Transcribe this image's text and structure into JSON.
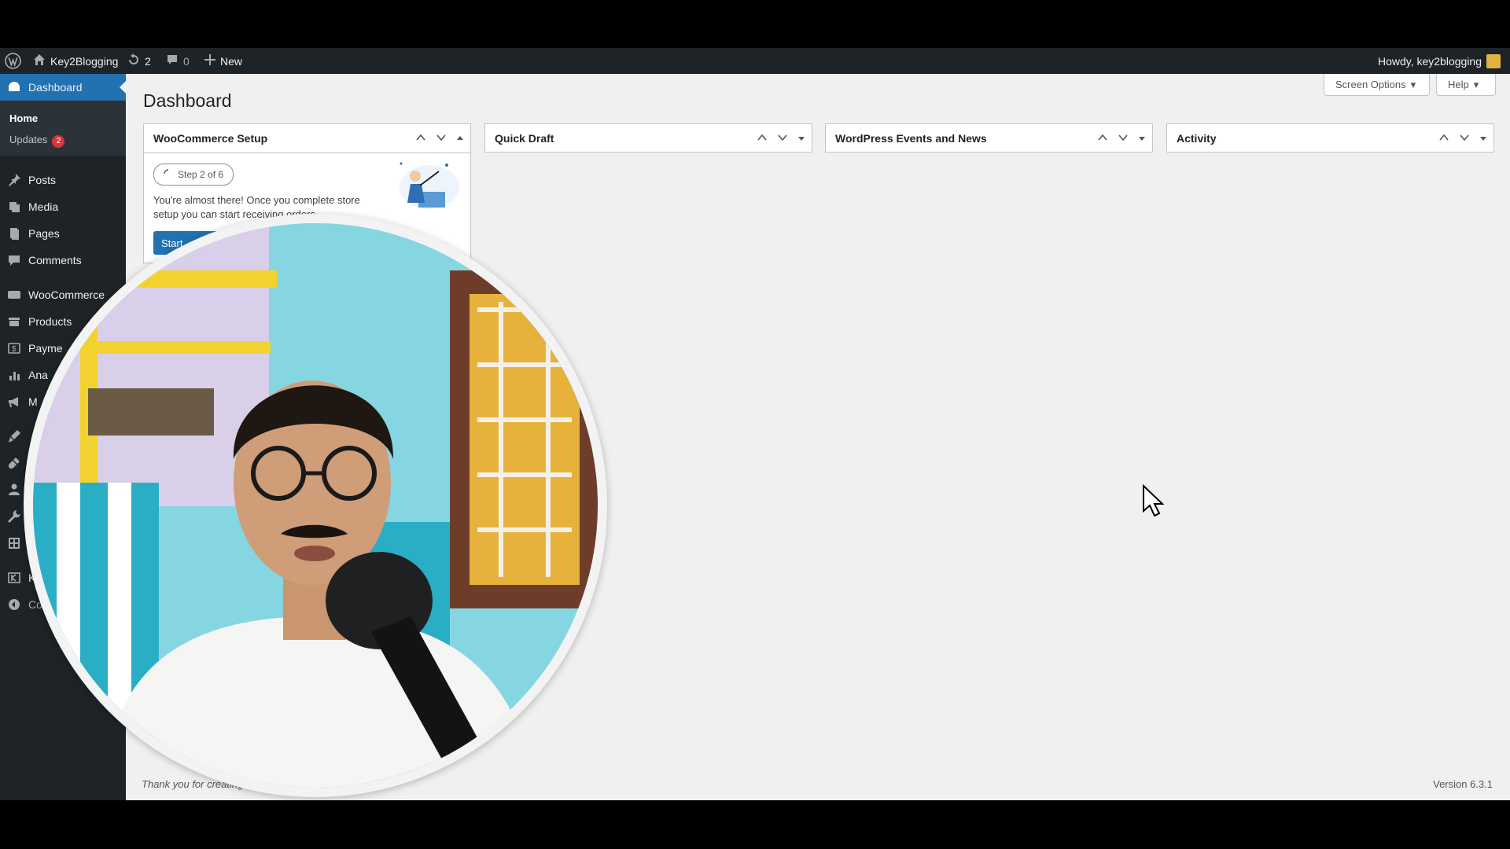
{
  "adminbar": {
    "site_name": "Key2Blogging",
    "updates_count": "2",
    "comments_count": "0",
    "new_label": "New",
    "howdy": "Howdy, key2blogging"
  },
  "sidebar": {
    "dashboard_label": "Dashboard",
    "submenu": {
      "home": "Home",
      "updates": "Updates",
      "updates_badge": "2"
    },
    "items": [
      {
        "label": "Posts",
        "icon": "pin-icon"
      },
      {
        "label": "Media",
        "icon": "media-icon"
      },
      {
        "label": "Pages",
        "icon": "pages-icon"
      },
      {
        "label": "Comments",
        "icon": "comment-icon"
      },
      {
        "label": "WooCommerce",
        "icon": "woo-icon"
      },
      {
        "label": "Products",
        "icon": "products-icon"
      },
      {
        "label": "Payme",
        "icon": "payments-icon"
      },
      {
        "label": "Ana",
        "icon": "analytics-icon"
      },
      {
        "label": "M",
        "icon": "marketing-icon"
      },
      {
        "label": "",
        "icon": "appearance-icon"
      },
      {
        "label": "",
        "icon": "plugins-icon"
      },
      {
        "label": "",
        "icon": "users-icon"
      },
      {
        "label": "",
        "icon": "tools-icon"
      },
      {
        "label": "",
        "icon": "settings-icon"
      },
      {
        "label": "K",
        "icon": "kadence-icon"
      },
      {
        "label": "Col",
        "icon": "collapse-icon"
      }
    ]
  },
  "main": {
    "title": "Dashboard",
    "screen_options": "Screen Options",
    "help": "Help",
    "widgets": {
      "woo_setup": {
        "title": "WooCommerce Setup",
        "step": "Step 2 of 6",
        "text": "You're almost there! Once you complete store setup you can start receiving orders.",
        "button": "Start"
      },
      "quick_draft": {
        "title": "Quick Draft"
      },
      "events": {
        "title": "WordPress Events and News"
      },
      "activity": {
        "title": "Activity"
      }
    },
    "footer_thanks": "Thank you for creating with WordPress.",
    "version": "Version 6.3.1"
  },
  "colors": {
    "adminbar_bg": "#1d2327",
    "accent": "#2271b1",
    "badge": "#d63638",
    "canvas": "#f0f0f1"
  }
}
